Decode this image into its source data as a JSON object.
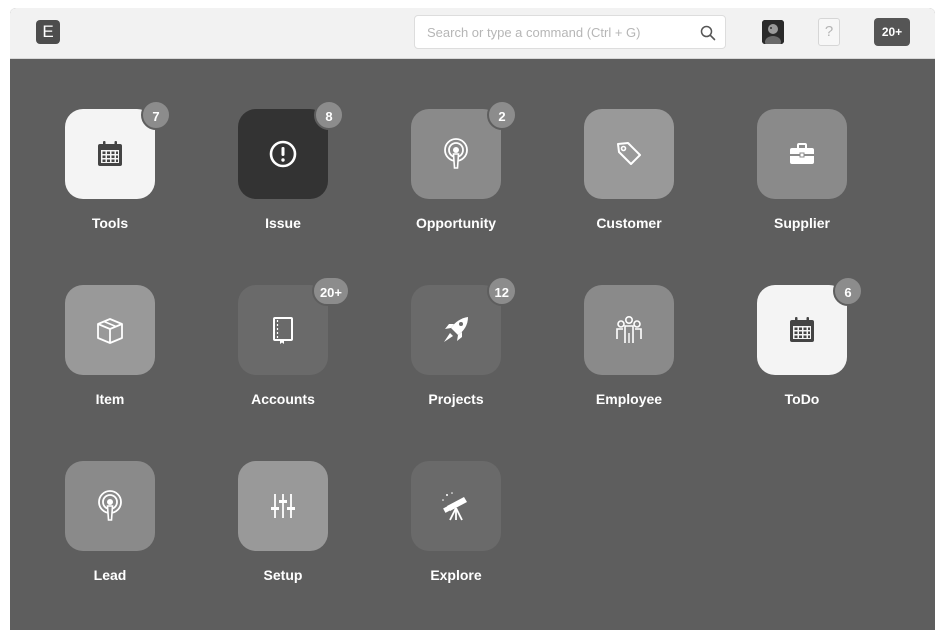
{
  "navbar": {
    "logo_letter": "E",
    "search_placeholder": "Search or type a command (Ctrl + G)",
    "help_label": "?",
    "notifications_count": "20+"
  },
  "modules": [
    {
      "label": "Tools",
      "badge": "7",
      "icon": "calendar-icon"
    },
    {
      "label": "Issue",
      "badge": "8",
      "icon": "exclamation-circle-icon"
    },
    {
      "label": "Opportunity",
      "badge": "2",
      "icon": "broadcast-icon"
    },
    {
      "label": "Customer",
      "badge": "",
      "icon": "tag-icon"
    },
    {
      "label": "Supplier",
      "badge": "",
      "icon": "briefcase-icon"
    },
    {
      "label": "Item",
      "badge": "",
      "icon": "box-icon"
    },
    {
      "label": "Accounts",
      "badge": "20+",
      "icon": "book-icon"
    },
    {
      "label": "Projects",
      "badge": "12",
      "icon": "rocket-icon"
    },
    {
      "label": "Employee",
      "badge": "",
      "icon": "group-icon"
    },
    {
      "label": "ToDo",
      "badge": "6",
      "icon": "calendar-icon"
    },
    {
      "label": "Lead",
      "badge": "",
      "icon": "broadcast-icon"
    },
    {
      "label": "Setup",
      "badge": "",
      "icon": "sliders-icon"
    },
    {
      "label": "Explore",
      "badge": "",
      "icon": "telescope-icon"
    }
  ],
  "colors": {
    "desk_background": "#5e5e5e",
    "navbar_background": "#f2f2f2",
    "badge_background": "#8c8c8c"
  }
}
